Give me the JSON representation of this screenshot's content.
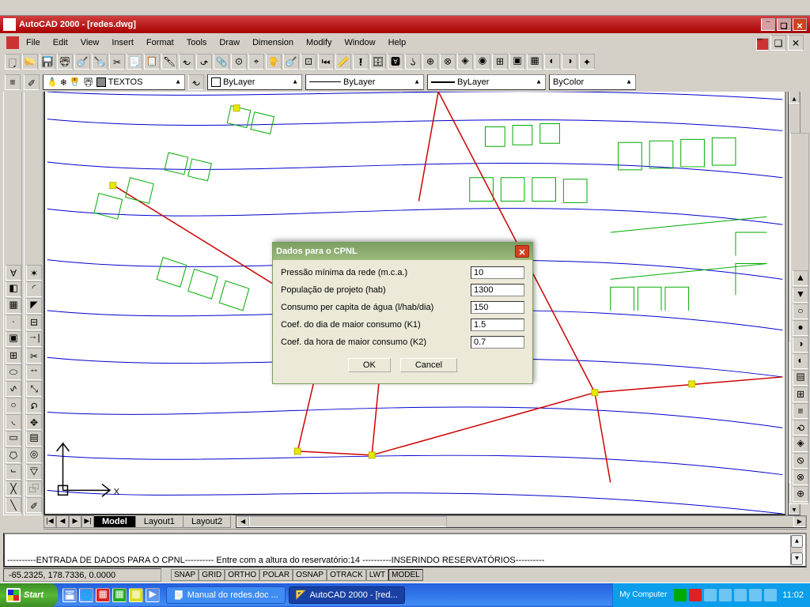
{
  "taskbar": {
    "start": "Start",
    "tasks": [
      {
        "label": "Manual do redes.doc ..."
      },
      {
        "label": "AutoCAD 2000 - [red..."
      }
    ],
    "tray_label": "My Computer",
    "clock": "11:02"
  },
  "status": {
    "coords": "-65.2325, 178.7336, 0.0000",
    "toggles": [
      "SNAP",
      "GRID",
      "ORTHO",
      "POLAR",
      "OSNAP",
      "OTRACK",
      "LWT",
      "MODEL"
    ],
    "active_toggle": "MODEL"
  },
  "command": {
    "line1": "----------ENTRADA DE DADOS PARA O CPNL----------",
    "line2": "Entre com a altura do reservatório:14",
    "line3": "----------INSERINDO RESERVATÓRIOS----------"
  },
  "tabs": {
    "items": [
      "Model",
      "Layout1",
      "Layout2"
    ],
    "active": 0
  },
  "properties": {
    "layer": "TEXTOS",
    "color": "ByLayer",
    "ltype": "ByLayer",
    "lweight": "ByLayer",
    "plotstyle": "ByColor"
  },
  "menu": [
    "File",
    "Edit",
    "View",
    "Insert",
    "Format",
    "Tools",
    "Draw",
    "Dimension",
    "Modify",
    "Window",
    "Help"
  ],
  "title": "AutoCAD 2000 - [redes.dwg]",
  "dialog": {
    "title": "Dados para o CPNL",
    "fields": [
      {
        "label": "Pressão mínima da rede (m.c.a.)",
        "value": "10"
      },
      {
        "label": "População de projeto (hab)",
        "value": "1300"
      },
      {
        "label": "Consumo per capita de água (l/hab/dia)",
        "value": "150"
      },
      {
        "label": "Coef. do dia de maior consumo (K1)",
        "value": "1.5"
      },
      {
        "label": "Coef. da hora de maior consumo (K2)",
        "value": "0.7"
      }
    ],
    "ok": "OK",
    "cancel": "Cancel"
  }
}
